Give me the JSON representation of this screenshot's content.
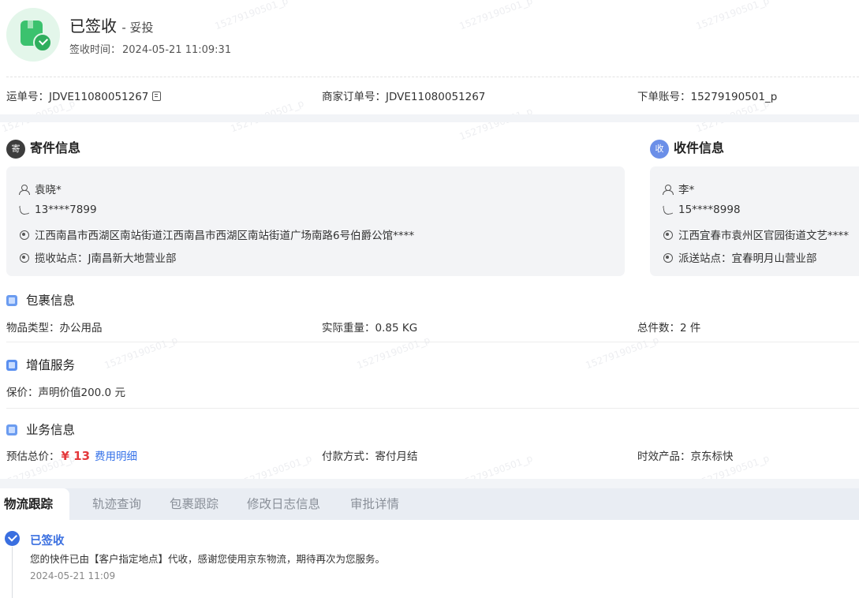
{
  "header": {
    "status": "已签收",
    "substatus": "- 妥投",
    "sign_time_label": "签收时间：",
    "sign_time": "2024-05-21 11:09:31"
  },
  "ids": {
    "waybill_label": "运单号：",
    "waybill": "JDVE11080051267",
    "merchant_order_label": "商家订单号：",
    "merchant_order": "JDVE11080051267",
    "account_label": "下单账号：",
    "account": "15279190501_p"
  },
  "sender": {
    "badge": "寄",
    "title": "寄件信息",
    "badge_color": "#3d3d3d",
    "name": "袁晓*",
    "phone": "13****7899",
    "address": "江西南昌市西湖区南站街道江西南昌市西湖区南站街道广场南路6号伯爵公馆****",
    "station": "揽收站点：J南昌新大地营业部"
  },
  "receiver": {
    "badge": "收",
    "title": "收件信息",
    "badge_color": "#6b8fe8",
    "name": "李*",
    "phone": "15****8998",
    "address": "江西宜春市袁州区官园街道文艺****",
    "station": "派送站点：宜春明月山营业部"
  },
  "package": {
    "title": "包裹信息",
    "type": "物品类型：办公用品",
    "weight": "实际重量：0.85 KG",
    "count": "总件数：2 件"
  },
  "value_added": {
    "title": "增值服务",
    "insure": "保价：声明价值200.0 元"
  },
  "business": {
    "title": "业务信息",
    "estimate_label": "预估总价：",
    "price": "¥ 13",
    "fee_link": "费用明细",
    "payment": "付款方式：寄付月结",
    "product": "时效产品：京东标快"
  },
  "tabs": [
    "物流跟踪",
    "轨迹查询",
    "包裹跟踪",
    "修改日志信息",
    "审批详情"
  ],
  "timeline": {
    "status": "已签收",
    "desc": "您的快件已由【客户指定地点】代收，感谢您使用京东物流，期待再次为您服务。",
    "time": "2024-05-21 11:09"
  },
  "watermark": "15279190501_p",
  "colors": {
    "accent": "#3370e8",
    "price": "#e4393c",
    "success": "#3bc26e"
  }
}
